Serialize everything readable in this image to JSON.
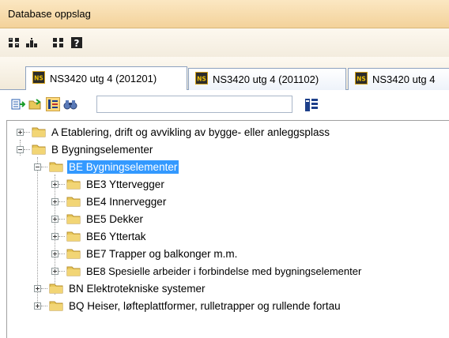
{
  "window": {
    "title": "Database oppslag"
  },
  "toolbar": {
    "icons": [
      "expand-all-icon",
      "collapse-icon",
      "grid-icon",
      "help-icon"
    ]
  },
  "tabs": [
    {
      "label": "NS3420 utg 4 (201201)",
      "badge": "NS",
      "active": true
    },
    {
      "label": "NS3420 utg 4 (201102)",
      "badge": "NS",
      "active": false
    },
    {
      "label": "NS3420 utg 4",
      "badge": "NS",
      "active": false
    }
  ],
  "search_toolbar": {
    "icons": [
      "import-icon",
      "open-folder-icon",
      "tree-view-icon",
      "binoculars-icon"
    ],
    "search_value": "",
    "search_button_icon": "search-go-icon"
  },
  "tree": {
    "items": [
      {
        "label": "A Etablering, drift og avvikling av bygge- eller anleggsplass",
        "expanded": false
      },
      {
        "label": "B Bygningselementer",
        "expanded": true
      },
      {
        "label": "BE Bygningselementer",
        "expanded": true,
        "selected": true
      },
      {
        "label": "BE3 Yttervegger",
        "expanded": false
      },
      {
        "label": "BE4 Innervegger",
        "expanded": false
      },
      {
        "label": "BE5 Dekker",
        "expanded": false
      },
      {
        "label": "BE6 Yttertak",
        "expanded": false
      },
      {
        "label": "BE7 Trapper og balkonger m.m.",
        "expanded": false
      },
      {
        "label": "BE8 Spesielle arbeider i forbindelse med bygningselementer",
        "expanded": false
      },
      {
        "label": "BN Elektrotekniske systemer",
        "expanded": false
      },
      {
        "label": "BQ Heiser, løfteplattformer, rulletrapper og rullende fortau",
        "expanded": false
      }
    ]
  },
  "colors": {
    "titlebar": "#f3d29a",
    "selection": "#3399ff",
    "folder": "#e8c85a",
    "badge": "#2b2b2b"
  }
}
